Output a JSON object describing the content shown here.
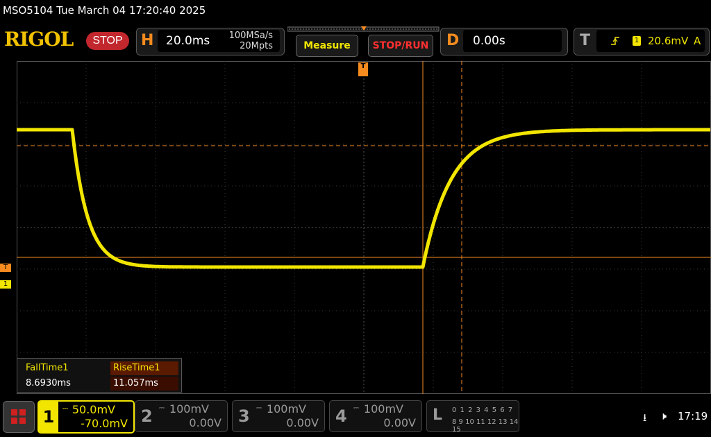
{
  "title_bar": {
    "text": "MSO5104  Tue March 04 17:20:40 2025"
  },
  "brand": {
    "logo": "RIGOL",
    "status": "STOP"
  },
  "horizontal": {
    "letter": "H",
    "timebase": "20.0ms",
    "sample_rate": "100MSa/s",
    "memory_depth": "20Mpts"
  },
  "buttons": {
    "measure": "Measure",
    "stop_run": "STOP/RUN"
  },
  "delay": {
    "letter": "D",
    "value": "0.00s"
  },
  "trigger": {
    "letter": "T",
    "channel": "1",
    "level": "20.6mV",
    "mode": "A",
    "slope_icon": "rising-edge-icon"
  },
  "markers": {
    "trigger_level": "T",
    "channel1": "1",
    "trigger_position": "T"
  },
  "measurements": {
    "headers": [
      "FallTime1",
      "RiseTime1"
    ],
    "values": [
      "8.6930ms",
      "11.057ms"
    ]
  },
  "channels": [
    {
      "num": "1",
      "scale": "50.0mV",
      "offset": "-70.0mV",
      "active": true,
      "color": "#f2e600"
    },
    {
      "num": "2",
      "scale": "100mV",
      "offset": "0.00V",
      "active": false
    },
    {
      "num": "3",
      "scale": "100mV",
      "offset": "0.00V",
      "active": false
    },
    {
      "num": "4",
      "scale": "100mV",
      "offset": "0.00V",
      "active": false
    }
  ],
  "logic": {
    "letter": "L",
    "row1": "0 1 2 3  4 5 6 7",
    "row2": "8 9 10 11 12 13 14 15"
  },
  "status": {
    "usb_icon": "usb-icon",
    "sound_icon": "speaker-muted-icon",
    "time": "17:19"
  },
  "colors": {
    "trace": "#f2e600",
    "accent": "#f68b1f",
    "stop": "#c1272d"
  }
}
